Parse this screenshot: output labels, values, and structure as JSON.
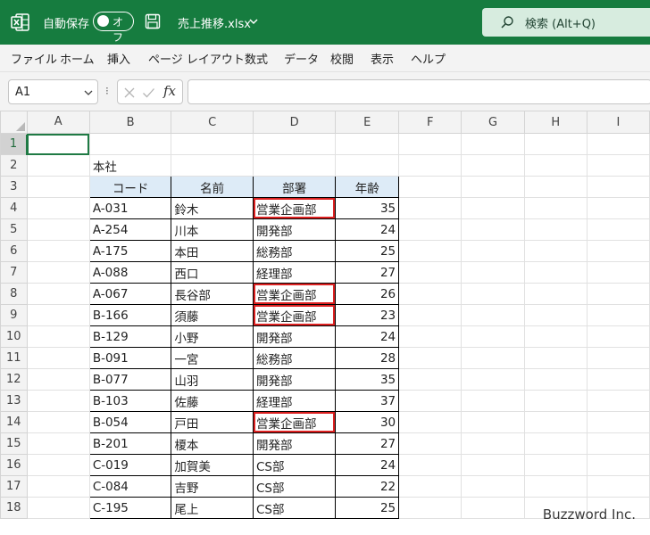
{
  "titlebar": {
    "autosave_label": "自動保存",
    "autosave_state": "オフ",
    "filename": "売上推移.xlsx",
    "search_text": "検索 (Alt+Q)",
    "bg_color": "#167c3f"
  },
  "menu": [
    "ファイル",
    "ホーム",
    "挿入",
    "ページ レイアウト",
    "数式",
    "データ",
    "校閲",
    "表示",
    "ヘルプ"
  ],
  "formula_bar": {
    "name_box": "A1",
    "formula": ""
  },
  "grid": {
    "columns": [
      "A",
      "B",
      "C",
      "D",
      "E",
      "F",
      "G",
      "H",
      "I"
    ],
    "selected_cell": "A1",
    "a2_text": "本社",
    "headers": [
      "コード",
      "名前",
      "部署",
      "年齢"
    ],
    "rows": [
      [
        "A-031",
        "鈴木",
        "営業企画部",
        "35"
      ],
      [
        "A-254",
        "川本",
        "開発部",
        "24"
      ],
      [
        "A-175",
        "本田",
        "総務部",
        "25"
      ],
      [
        "A-088",
        "西口",
        "経理部",
        "27"
      ],
      [
        "A-067",
        "長谷部",
        "営業企画部",
        "26"
      ],
      [
        "B-166",
        "須藤",
        "営業企画部",
        "23"
      ],
      [
        "B-129",
        "小野",
        "開発部",
        "24"
      ],
      [
        "B-091",
        "一宮",
        "総務部",
        "28"
      ],
      [
        "B-077",
        "山羽",
        "開発部",
        "35"
      ],
      [
        "B-103",
        "佐藤",
        "経理部",
        "37"
      ],
      [
        "B-054",
        "戸田",
        "営業企画部",
        "30"
      ],
      [
        "B-201",
        "榎本",
        "開発部",
        "27"
      ],
      [
        "C-019",
        "加賀美",
        "CS部",
        "24"
      ],
      [
        "C-084",
        "吉野",
        "CS部",
        "22"
      ],
      [
        "C-195",
        "尾上",
        "CS部",
        "25"
      ]
    ],
    "highlight_value": "営業企画部",
    "highlight_color": "#dd2222"
  },
  "watermark": "Buzzword Inc."
}
